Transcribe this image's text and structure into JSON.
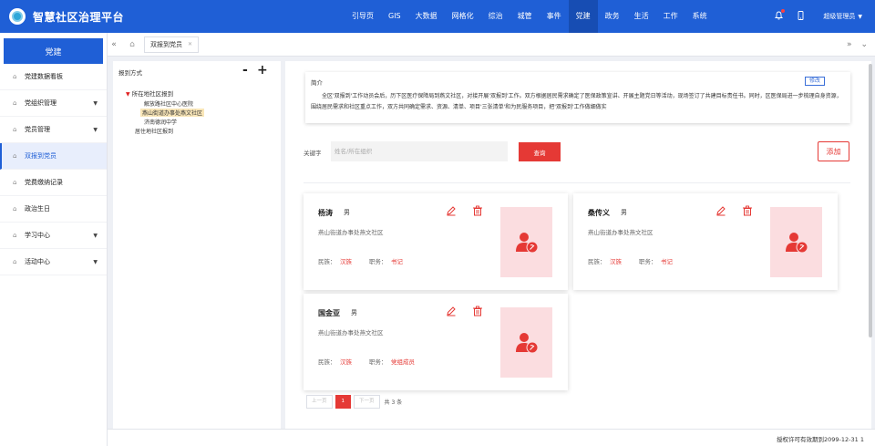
{
  "app": {
    "title": "智慧社区治理平台"
  },
  "topnav": {
    "items": [
      "引导页",
      "GIS",
      "大数据",
      "网格化",
      "综治",
      "城管",
      "事件",
      "党建",
      "政务",
      "生活",
      "工作",
      "系统"
    ],
    "active_index": 7
  },
  "header_right": {
    "user": "超级管理员"
  },
  "sidebar": {
    "header": "党建",
    "items": [
      {
        "label": "党建数据看板",
        "has_submenu": false
      },
      {
        "label": "党组织管理",
        "has_submenu": true
      },
      {
        "label": "党员管理",
        "has_submenu": true
      },
      {
        "label": "双报到党员",
        "has_submenu": false
      },
      {
        "label": "党费缴纳记录",
        "has_submenu": false
      },
      {
        "label": "政治生日",
        "has_submenu": false
      },
      {
        "label": "学习中心",
        "has_submenu": true
      },
      {
        "label": "活动中心",
        "has_submenu": true
      }
    ],
    "active_index": 3
  },
  "tabs": {
    "items": [
      {
        "label": "双报到党员"
      }
    ]
  },
  "tree": {
    "title": "报到方式",
    "minus": "-",
    "plus": "+",
    "root": "所在地社区报到",
    "children": [
      "解放路社区中心医院",
      "燕山街道办事处燕文社区",
      "济南德润中学"
    ],
    "selected_index": 1,
    "sibling": "居住地社区报到"
  },
  "intro": {
    "title": "简介",
    "edit_label": "修改",
    "text": "全区'双报到'工作动员会后，历下区医疗保障局到燕文社区，对接开展'双报到'工作。双方根据居民需求确定了医保政策宣讲、开展主题党日等活动，现场签订了共建目标责任书。同时，区医保局进一步梳理自身资源，围绕居民需求和社区重点工作，双方共同确定需求、资源、清单、项目'三张清单'和为民服务项目，把'双报到'工作做细做实"
  },
  "search": {
    "label": "关键字",
    "placeholder": "姓名/所在组织",
    "query_label": "查询",
    "add_label": "添加"
  },
  "members": [
    {
      "name": "杨涛",
      "gender": "男",
      "org": "燕山街道办事处燕文社区",
      "ethnicity_label": "民族：",
      "ethnicity": "汉族",
      "position_label": "职务：",
      "position": "书记"
    },
    {
      "name": "桑传义",
      "gender": "男",
      "org": "燕山街道办事处燕文社区",
      "ethnicity_label": "民族：",
      "ethnicity": "汉族",
      "position_label": "职务：",
      "position": "书记"
    },
    {
      "name": "国金亚",
      "gender": "男",
      "org": "燕山街道办事处燕文社区",
      "ethnicity_label": "民族：",
      "ethnicity": "汉族",
      "position_label": "职务：",
      "position": "党组成员"
    }
  ],
  "pager": {
    "prev": "上一页",
    "current": "1",
    "next": "下一页",
    "total": "共 3 条"
  },
  "footer": {
    "license": "授权许可有效期到2099-12-31 1"
  },
  "colors": {
    "primary": "#1f5fd6",
    "accent": "#e53935",
    "photo_bg": "#fbdde0"
  }
}
